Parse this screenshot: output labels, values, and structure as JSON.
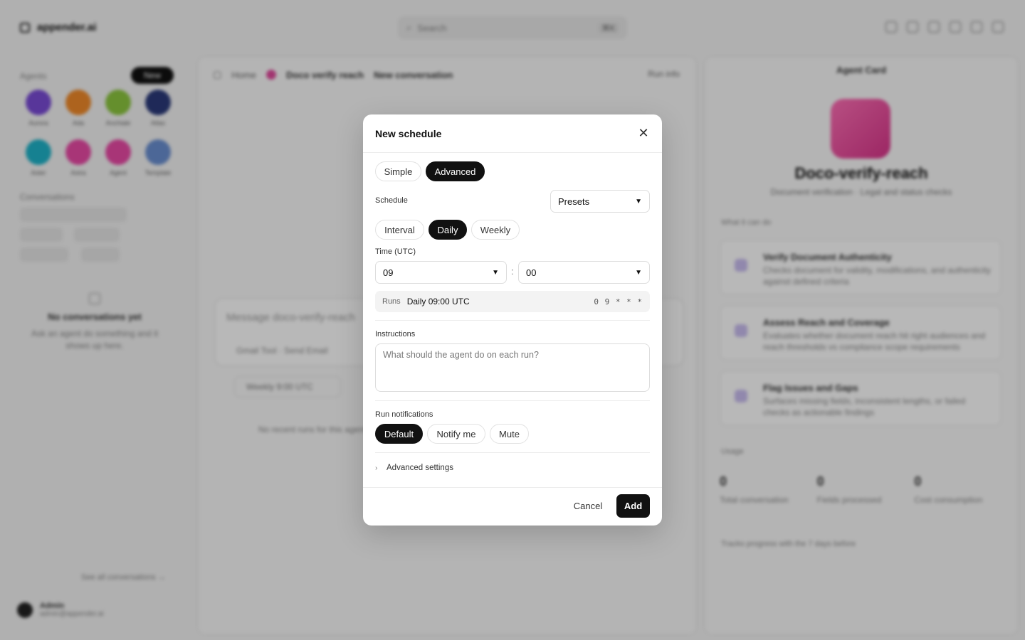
{
  "app": {
    "brand": "appender.ai",
    "search_placeholder": "Search",
    "search_shortcut": "⌘K"
  },
  "sidebar": {
    "agents_label": "Agents",
    "new_label": "New",
    "agents": [
      {
        "name": "Aurora",
        "color": "#7a4bd6"
      },
      {
        "name": "Ada",
        "color": "#f08a2a"
      },
      {
        "name": "Anchiale",
        "color": "#8cc63f"
      },
      {
        "name": "Atlas",
        "color": "#2b3a7a"
      },
      {
        "name": "Aster",
        "color": "#1fb3c9"
      },
      {
        "name": "Astra",
        "color": "#e94aa6"
      },
      {
        "name": "Agent",
        "color": "#e94aa6"
      },
      {
        "name": "Template",
        "color": "#6a8fd1"
      }
    ],
    "conversations_label": "Conversations",
    "empty_title": "No conversations yet",
    "empty_sub": "Ask an agent do something and it shows up here.",
    "see_all": "See all conversations →",
    "user_name": "Admin",
    "user_email": "admin@appender.ai"
  },
  "center": {
    "crumb_home": "Home",
    "crumb_agent": "Doco verify reach",
    "crumb_convo": "New conversation",
    "share": "Run info",
    "composer_placeholder": "Message doco-verify-reach",
    "composer_row": "Gmail Tool · Send Email",
    "chip": "Weekly 9:00 UTC",
    "note": "No recent runs for this agent yet"
  },
  "right_panel": {
    "header": "Agent Card",
    "agent_name": "Doco-verify-reach",
    "agent_desc": "Document verification · Legal and status checks",
    "section_start": "What it can do",
    "cards": [
      {
        "title": "Verify Document Authenticity",
        "desc": "Checks document for validity, modifications, and authenticity against defined criteria"
      },
      {
        "title": "Assess Reach and Coverage",
        "desc": "Evaluates whether document reach hit right audiences and reach thresholds vs compliance scope requirements"
      },
      {
        "title": "Flag Issues and Gaps",
        "desc": "Surfaces missing fields, inconsistent lengths, or failed checks as actionable findings"
      }
    ],
    "section_usage": "Usage",
    "stats": [
      {
        "value": "0",
        "label": "Total conversation"
      },
      {
        "value": "0",
        "label": "Fields processed"
      },
      {
        "value": "0",
        "label": "Cost consumption"
      }
    ],
    "footer": "Tracks progress with the 7 days before"
  },
  "modal": {
    "title": "New schedule",
    "mode_tabs": [
      {
        "label": "Simple",
        "active": false
      },
      {
        "label": "Advanced",
        "active": true
      }
    ],
    "schedule_label": "Schedule",
    "presets_value": "Presets",
    "freq_tabs": [
      {
        "label": "Interval",
        "active": false
      },
      {
        "label": "Daily",
        "active": true
      },
      {
        "label": "Weekly",
        "active": false
      }
    ],
    "time_label": "Time (UTC)",
    "hour_value": "09",
    "minute_value": "00",
    "colon": ":",
    "runs_label": "Runs",
    "runs_value": "Daily 09:00 UTC",
    "cron": "0 9 * * *",
    "instructions_label": "Instructions",
    "instructions_placeholder": "What should the agent do on each run?",
    "notifications_label": "Run notifications",
    "notify_tabs": [
      {
        "label": "Default",
        "active": true
      },
      {
        "label": "Notify me",
        "active": false
      },
      {
        "label": "Mute",
        "active": false
      }
    ],
    "advanced_settings": "Advanced settings",
    "cancel_label": "Cancel",
    "add_label": "Add"
  },
  "icons": {
    "close": "close-icon",
    "chevron_down": "chevron-down-icon",
    "chevron_right": "chevron-right-icon"
  },
  "colors": {
    "accent": "#111111",
    "overlay": "rgba(0,0,0,0.28)"
  }
}
